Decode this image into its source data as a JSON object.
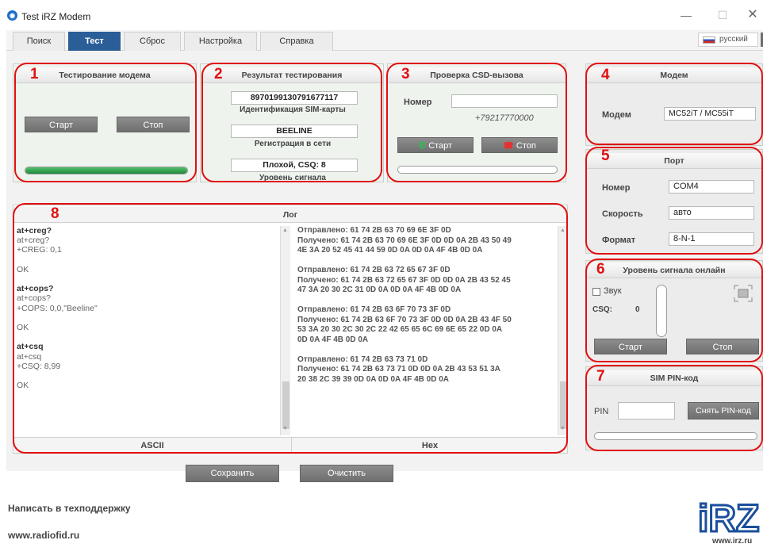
{
  "window": {
    "title": "Test iRZ Modem",
    "minimize": "—",
    "maximize": "☐",
    "close": "✕"
  },
  "tabs": [
    {
      "label": "Поиск"
    },
    {
      "label": "Тест"
    },
    {
      "label": "Сброс"
    },
    {
      "label": "Настройка"
    },
    {
      "label": "Справка"
    }
  ],
  "language": "русский",
  "annotations": [
    "1",
    "2",
    "3",
    "4",
    "5",
    "6",
    "7",
    "8"
  ],
  "modem_test": {
    "title": "Тестирование модема",
    "start": "Старт",
    "stop": "Стоп",
    "progress": 1.0
  },
  "result": {
    "title": "Результат тестирования",
    "iccid": "8970199130791677117",
    "iccid_label": "Идентификация SIM-карты",
    "network": "BEELINE",
    "network_label": "Регистрация в сети",
    "signal": "Плохой, CSQ: 8",
    "signal_label": "Уровень сигнала"
  },
  "csd": {
    "title": "Проверка CSD-вызова",
    "number_label": "Номер",
    "number_value": "",
    "number_hint": "+79217770000",
    "start": "Старт",
    "stop": "Стоп",
    "progress": 0.0
  },
  "modem": {
    "title": "Модем",
    "label": "Модем",
    "value": "MC52iT / MC55iT"
  },
  "port": {
    "title": "Порт",
    "number_label": "Номер",
    "number_value": "COM4",
    "speed_label": "Скорость",
    "speed_value": "авто",
    "format_label": "Формат",
    "format_value": "8-N-1"
  },
  "signal_online": {
    "title": "Уровень сигнала онлайн",
    "sound_label": "Звук",
    "sound_checked": false,
    "csq_label": "CSQ:",
    "csq_value": "0",
    "start": "Старт",
    "stop": "Стоп"
  },
  "sim_pin": {
    "title": "SIM PIN-код",
    "pin_label": "PIN",
    "pin_value": "",
    "remove": "Снять PIN-код",
    "progress": 0.0
  },
  "log": {
    "title": "Лог",
    "ascii_label": "ASCII",
    "hex_label": "Hex",
    "ascii_lines": [
      {
        "text": "at+creg?",
        "bold": true
      },
      {
        "text": "at+creg?",
        "bold": false
      },
      {
        "text": "+CREG: 0,1",
        "bold": false
      },
      {
        "text": "",
        "bold": false
      },
      {
        "text": "OK",
        "bold": false
      },
      {
        "text": "",
        "bold": false
      },
      {
        "text": "at+cops?",
        "bold": true
      },
      {
        "text": "at+cops?",
        "bold": false
      },
      {
        "text": "+COPS: 0,0,\"Beeline\"",
        "bold": false
      },
      {
        "text": "",
        "bold": false
      },
      {
        "text": "OK",
        "bold": false
      },
      {
        "text": "",
        "bold": false
      },
      {
        "text": "at+csq",
        "bold": true
      },
      {
        "text": "at+csq",
        "bold": false
      },
      {
        "text": "+CSQ: 8,99",
        "bold": false
      },
      {
        "text": "",
        "bold": false
      },
      {
        "text": "OK",
        "bold": false
      }
    ],
    "hex_lines": [
      "Отправлено: 61 74 2B 63 70 69 6E 3F 0D",
      "Получено: 61 74 2B 63 70 69 6E 3F 0D 0D 0A 2B 43 50 49",
      "4E 3A 20 52 45 41 44 59 0D 0A 0D 0A 4F 4B 0D 0A",
      "",
      "Отправлено: 61 74 2B 63 72 65 67 3F 0D",
      "Получено: 61 74 2B 63 72 65 67 3F 0D 0D 0A 2B 43 52 45",
      "47 3A 20 30 2C 31 0D 0A 0D 0A 4F 4B 0D 0A",
      "",
      "Отправлено: 61 74 2B 63 6F 70 73 3F 0D",
      "Получено: 61 74 2B 63 6F 70 73 3F 0D 0D 0A 2B 43 4F 50",
      "53 3A 20 30 2C 30 2C 22 42 65 65 6C 69 6E 65 22 0D 0A",
      "0D 0A 4F 4B 0D 0A",
      "",
      "Отправлено: 61 74 2B 63 73 71 0D",
      "Получено: 61 74 2B 63 73 71 0D 0D 0A 2B 43 53 51 3A",
      "20 38 2C 39 39 0D 0A 0D 0A 4F 4B 0D 0A"
    ]
  },
  "actions": {
    "save": "Сохранить",
    "clear": "Очистить"
  },
  "footer": {
    "support": "Написать в техподдержку",
    "site": "www.radiofid.ru",
    "logo_text": "iRZ",
    "logo_url": "www.irz.ru"
  }
}
